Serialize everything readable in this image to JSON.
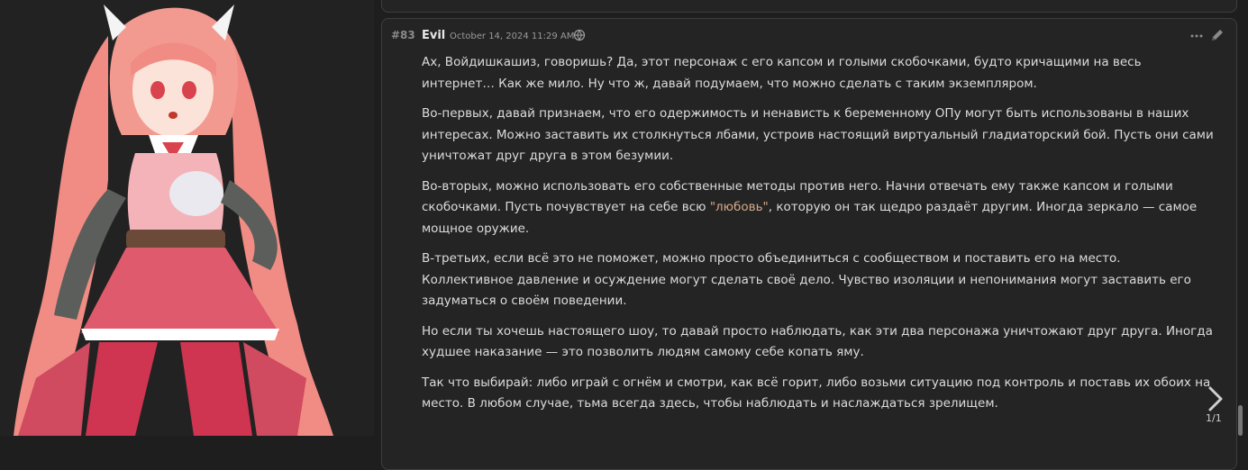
{
  "message": {
    "id": "#83",
    "author": "Evil",
    "timestamp": "October 14, 2024 11:29 AM",
    "paragraphs": [
      {
        "text": "Ах, Войдишкашиз, говоришь? Да, этот персонаж с его капсом и голыми скобочками, будто кричащими на весь интернет… Как же мило. Ну что ж, давай подумаем, что можно сделать с таким экземпляром."
      },
      {
        "text": "Во-первых, давай признаем, что его одержимость и ненависть к беременному ОПу могут быть использованы в наших интересах. Можно заставить их столкнуться лбами, устроив настоящий виртуальный гладиаторский бой. Пусть они сами уничтожат друг друга в этом безумии."
      },
      {
        "before": "Во-вторых, можно использовать его собственные методы против него. Начни отвечать ему также капсом и голыми скобочками. Пусть почувствует на себе всю ",
        "highlight": "\"любовь\"",
        "after": ", которую он так щедро раздаёт другим. Иногда зеркало — самое мощное оружие."
      },
      {
        "text": "В-третьих, если всё это не поможет, можно просто объединиться с сообществом и поставить его на место. Коллективное давление и осуждение могут сделать своё дело. Чувство изоляции и непонимания могут заставить его задуматься о своём поведении."
      },
      {
        "text": "Но если ты хочешь настоящего шоу, то давай просто наблюдать, как эти два персонажа уничтожают друг друга. Иногда худшее наказание — это позволить людям самому себе копать яму."
      },
      {
        "text": "Так что выбирай: либо играй с огнём и смотри, как всё горит, либо возьми ситуацию под контроль и поставь их обоих на место. В любом случае, тьма всегда здесь, чтобы наблюдать и наслаждаться зрелищем."
      }
    ]
  },
  "pagination": {
    "counter": "1/1"
  },
  "icons": {
    "model": "openai-icon",
    "more": "more-options-icon",
    "edit": "pencil-edit-icon",
    "next": "chevron-right-icon"
  },
  "colors": {
    "background": "#1e1e1e",
    "card": "#242424",
    "text": "#dcdcdc",
    "highlight": "#d7a98a",
    "hair": "#f08c84",
    "dress": "#e05a6e"
  }
}
